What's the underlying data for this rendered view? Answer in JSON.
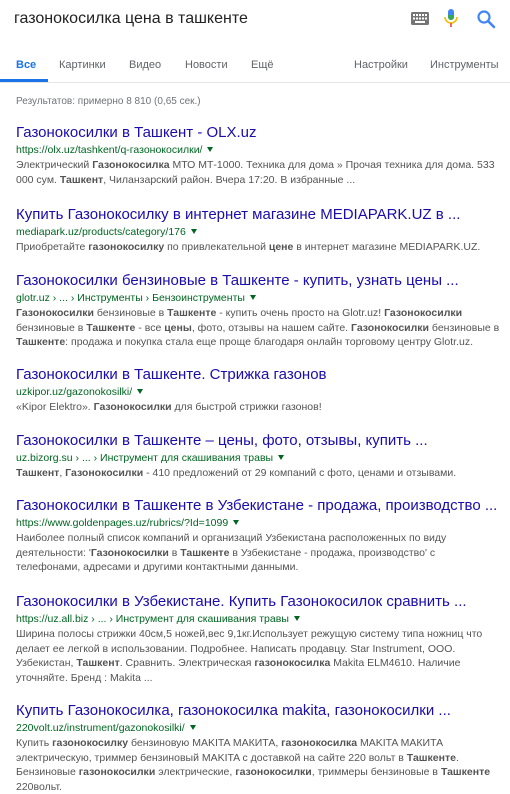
{
  "search": {
    "query": "газонокосилка цена в ташкенте",
    "icons": [
      "keyboard-icon",
      "microphone-icon",
      "search-icon"
    ]
  },
  "tabs": [
    {
      "label": "Все",
      "active": true
    },
    {
      "label": "Картинки"
    },
    {
      "label": "Видео"
    },
    {
      "label": "Новости"
    },
    {
      "label": "Ещё"
    },
    {
      "label": "Настройки"
    },
    {
      "label": "Инструменты"
    }
  ],
  "stats": "Результатов: примерно 8 810 (0,65 сек.)",
  "colors": {
    "title": "#1a0dab",
    "url": "#006621",
    "snippet": "#545454",
    "accent": "#1a73e8"
  },
  "results": [
    {
      "title": "Газонокосилки в Ташкент - OLX.uz",
      "url": "https://olx.uz/tashkent/q-газонокосилки/",
      "snippet": [
        [
          "Электрический ",
          0
        ],
        [
          "Газонокосилка",
          1
        ],
        [
          " МТО МТ-1000. Техника для дома » Прочая техника для дома. 533 000 сум. ",
          0
        ],
        [
          "Ташкент",
          1
        ],
        [
          ", Чиланзарский район. Вчера 17:20. В избранные ...",
          0
        ]
      ]
    },
    {
      "title": "Купить Газонокосилку в интернет магазине MEDIAPARK.UZ в ...",
      "url": "mediapark.uz/products/category/176",
      "snippet": [
        [
          "Приобретайте ",
          0
        ],
        [
          "газонокосилку",
          1
        ],
        [
          " по привлекательной ",
          0
        ],
        [
          "цене",
          1
        ],
        [
          " в интернет магазине MEDIAPARK.UZ.",
          0
        ]
      ]
    },
    {
      "title": "Газонокосилки бензиновые в Ташкенте - купить, узнать цены ...",
      "url": "glotr.uz › ... › Инструменты › Бензоинструменты",
      "snippet": [
        [
          "Газонокосилки",
          1
        ],
        [
          " бензиновые в ",
          0
        ],
        [
          "Ташкенте",
          1
        ],
        [
          " - купить очень просто на Glotr.uz! ",
          0
        ],
        [
          "Газонокосилки",
          1
        ],
        [
          " бензиновые в ",
          0
        ],
        [
          "Ташкенте",
          1
        ],
        [
          " - все ",
          0
        ],
        [
          "цены",
          1
        ],
        [
          ", фото, отзывы на нашем сайте. ",
          0
        ],
        [
          "Газонокосилки",
          1
        ],
        [
          " бензиновые в ",
          0
        ],
        [
          "Ташкенте",
          1
        ],
        [
          ": продажа и покупка стала еще проще благодаря онлайн торговому центру Glotr.uz.",
          0
        ]
      ]
    },
    {
      "title": "Газонокосилки в Ташкенте. Стрижка газонов",
      "url": "uzkipor.uz/gazonokosilki/",
      "snippet": [
        [
          "«Kipor Elektro». ",
          0
        ],
        [
          "Газонокосилки",
          1
        ],
        [
          " для быстрой стрижки газонов!",
          0
        ]
      ]
    },
    {
      "title": "Газонокосилки в Ташкенте – цены, фото, отзывы, купить ...",
      "url": "uz.bizorg.su › ... › Инструмент для скашивания травы",
      "snippet": [
        [
          "Ташкент",
          1
        ],
        [
          ", ",
          0
        ],
        [
          "Газонокосилки",
          1
        ],
        [
          " - 410 предложений от 29 компаний с фото, ценами и отзывами.",
          0
        ]
      ]
    },
    {
      "title": "Газонокосилки в Ташкенте в Узбекистане - продажа, производство ...",
      "url": "https://www.goldenpages.uz/rubrics/?Id=1099",
      "snippet": [
        [
          "Наиболее полный список компаний и организаций Узбекистана расположенных по виду деятельности: '",
          0
        ],
        [
          "Газонокосилки",
          1
        ],
        [
          " в ",
          0
        ],
        [
          "Ташкенте",
          1
        ],
        [
          " в Узбекистане - продажа, производство' с телефонами, адресами и другими контактными данными.",
          0
        ]
      ]
    },
    {
      "title": "Газонокосилки в Узбекистане. Купить Газонокосилок сравнить ...",
      "url": "https://uz.all.biz › ... › Инструмент для скашивания травы",
      "snippet": [
        [
          "Ширина полосы стрижки 40см,5 ножей,вес 9,1кг.Использует режущую систему типа ножниц что делает ее легкой в использовании. Подробнее. Написать продавцу. Star Instrument, ООО. Узбекистан, ",
          0
        ],
        [
          "Ташкент",
          1
        ],
        [
          ". Сравнить. Электрическая ",
          0
        ],
        [
          "газонокосилка",
          1
        ],
        [
          " Makita ELM4610. Наличие уточняйте. Бренд : Makita ...",
          0
        ]
      ]
    },
    {
      "title": "Купить Газонокосилка, газонокосилка makita, газонокосилки ...",
      "url": "220volt.uz/instrument/gazonokosilki/",
      "snippet": [
        [
          "Купить ",
          0
        ],
        [
          "газонокосилку",
          1
        ],
        [
          " бензиновую MAKITA МАКИТА, ",
          0
        ],
        [
          "газонокосилка",
          1
        ],
        [
          " MAKITA МАКИТА электрическую, триммер бензиновый MAKITA с доставкой на сайте 220 вольт в ",
          0
        ],
        [
          "Ташкенте",
          1
        ],
        [
          ". Бензиновые ",
          0
        ],
        [
          "газонокосилки",
          1
        ],
        [
          " электрические, ",
          0
        ],
        [
          "газонокосилки",
          1
        ],
        [
          ", триммеры бензиновые в ",
          0
        ],
        [
          "Ташкенте",
          1
        ],
        [
          " 220вольт.",
          0
        ]
      ]
    }
  ]
}
